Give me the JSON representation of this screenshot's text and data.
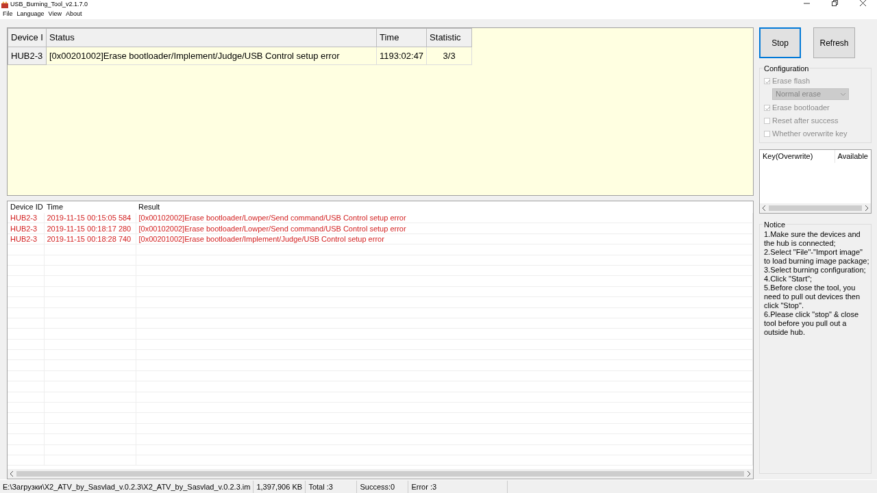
{
  "window": {
    "title": "USB_Burning_Tool_v2.1.7.0"
  },
  "menu": [
    "File",
    "Language",
    "View",
    "About"
  ],
  "devices": {
    "columns": [
      "Device I",
      "Status",
      "Time",
      "Statistic"
    ],
    "rows": [
      [
        "HUB2-3",
        "[0x00201002]Erase bootloader/Implement/Judge/USB Control setup error",
        "1193:02:47",
        "3/3"
      ]
    ]
  },
  "log": {
    "columns": [
      "Device ID",
      "Time",
      "Result"
    ],
    "rows": [
      {
        "cells": [
          "HUB2-3",
          "2019-11-15 00:15:05 584",
          "[0x00102002]Erase bootloader/Lowper/Send command/USB Control setup error"
        ],
        "error": true
      },
      {
        "cells": [
          "HUB2-3",
          "2019-11-15 00:18:17 280",
          "[0x00102002]Erase bootloader/Lowper/Send command/USB Control setup error"
        ],
        "error": true
      },
      {
        "cells": [
          "HUB2-3",
          "2019-11-15 00:18:28 740",
          "[0x00201002]Erase bootloader/Implement/Judge/USB Control setup error"
        ],
        "error": true
      }
    ]
  },
  "buttons": [
    {
      "label": "Stop",
      "focused": true
    },
    {
      "label": "Refresh",
      "focused": false
    }
  ],
  "configuration": {
    "title": "Configuration",
    "options": [
      {
        "kind": "checkbox",
        "label": "Erase flash",
        "checked": true,
        "disabled": true
      },
      {
        "kind": "dropdown",
        "value": "Normal erase",
        "disabled": true
      },
      {
        "kind": "checkbox",
        "label": "Erase bootloader",
        "checked": true,
        "disabled": true
      },
      {
        "kind": "checkbox",
        "label": "Reset after success",
        "checked": false,
        "disabled": true
      },
      {
        "kind": "checkbox",
        "label": "Whether overwrite key",
        "checked": false,
        "disabled": true
      }
    ]
  },
  "keys": {
    "columns": [
      "Key(Overwrite)",
      "Available"
    ]
  },
  "notice": {
    "title": "Notice",
    "lines": [
      "1.Make sure the devices and the hub is connected;",
      "2.Select \"File\"-\"Import image\" to load burning image package;",
      "3.Select burning configuration;",
      "4.Click \"Start\";",
      "5.Before close the tool, you need to pull out devices then click \"Stop\".",
      "6.Please click \"stop\" & close tool before you pull out a outside hub."
    ]
  },
  "status_bar": [
    "E:\\Загрузки\\X2_ATV_by_Sasvlad_v.0.2.3\\X2_ATV_by_Sasvlad_v.0.2.3.im",
    "1,397,906 KB",
    "Total :3",
    "Success:0",
    "Error :3"
  ]
}
